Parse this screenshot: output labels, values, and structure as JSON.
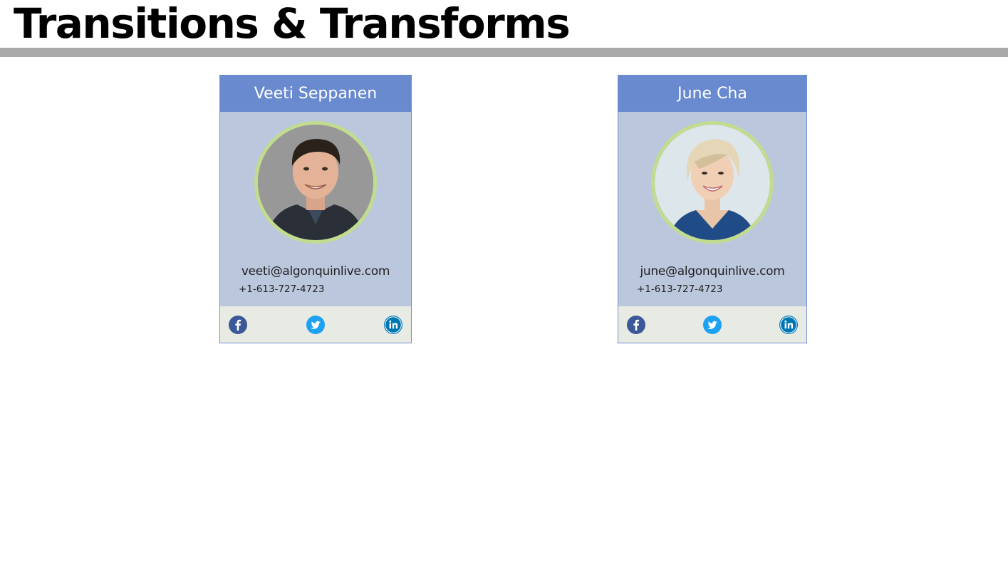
{
  "page": {
    "title": "Transitions & Transforms"
  },
  "cards": [
    {
      "name": "Veeti Seppanen",
      "email": "veeti@algonquinlive.com",
      "phone": "+1-613-727-4723",
      "photo_icon": "person-photo"
    },
    {
      "name": "June Cha",
      "email": "june@algonquinlive.com",
      "phone": "+1-613-727-4723",
      "photo_icon": "person-photo"
    }
  ],
  "social_icons": [
    "facebook-icon",
    "twitter-icon",
    "linkedin-icon"
  ],
  "colors": {
    "header_blue": "#6a8ad0",
    "card_body": "#bac7dd",
    "footer": "#e8ebe4",
    "avatar_ring": "#c2dc8f",
    "rule_gray": "#a9a9a9",
    "facebook": "#3b5998",
    "twitter": "#1da1f2",
    "linkedin": "#0077b5"
  }
}
